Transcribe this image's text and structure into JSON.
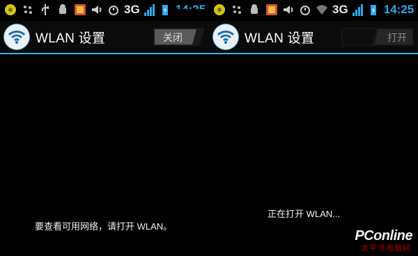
{
  "left": {
    "status": {
      "network": "3G",
      "time": "14:25"
    },
    "title": "WLAN 设置",
    "toggle_label": "关闭",
    "message": "要查看可用网络，请打开 WLAN。"
  },
  "right": {
    "status": {
      "network": "3G",
      "time": "14:25"
    },
    "title": "WLAN 设置",
    "toggle_label": "打开",
    "message": "正在打开 WLAN..."
  },
  "watermark": {
    "brand": "PConline",
    "sub": "太平洋电脑网"
  },
  "colors": {
    "accent": "#33b5e5",
    "status_blue": "#2aa7ea",
    "background": "#000000"
  },
  "icons": [
    "notification-icon",
    "ellipsis-icon",
    "usb-icon",
    "android-icon",
    "gallery-icon",
    "volume-icon",
    "alarm-icon",
    "wifi-icon",
    "signal-icon",
    "battery-icon"
  ]
}
